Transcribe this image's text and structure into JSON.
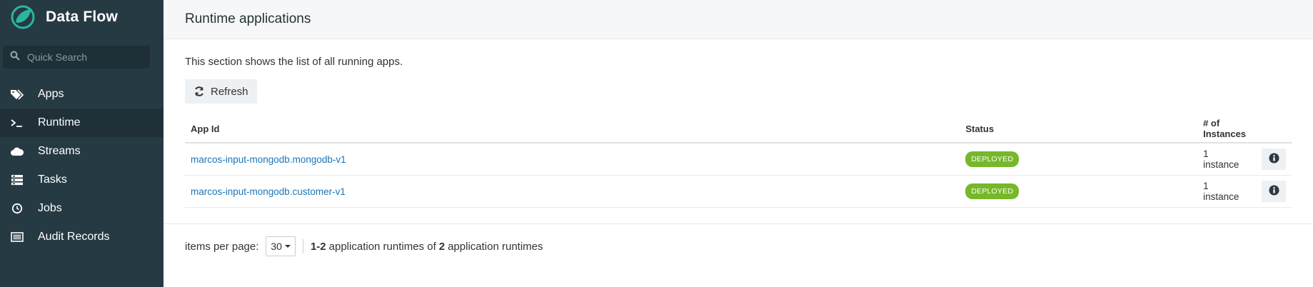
{
  "app": {
    "title": "Data Flow"
  },
  "sidebar": {
    "search_placeholder": "Quick Search",
    "items": [
      {
        "label": "Apps",
        "icon": "tags-icon"
      },
      {
        "label": "Runtime",
        "icon": "terminal-icon",
        "active": true
      },
      {
        "label": "Streams",
        "icon": "cloud-icon"
      },
      {
        "label": "Tasks",
        "icon": "tasks-icon"
      },
      {
        "label": "Jobs",
        "icon": "clock-icon"
      },
      {
        "label": "Audit Records",
        "icon": "list-icon"
      }
    ]
  },
  "header": {
    "title": "Runtime applications"
  },
  "main": {
    "description": "This section shows the list of all running apps.",
    "refresh_label": "Refresh",
    "table": {
      "columns": [
        "App Id",
        "Status",
        "# of Instances"
      ],
      "rows": [
        {
          "app_id": "marcos-input-mongodb.mongodb-v1",
          "status": "DEPLOYED",
          "instances": "1 instance"
        },
        {
          "app_id": "marcos-input-mongodb.customer-v1",
          "status": "DEPLOYED",
          "instances": "1 instance"
        }
      ]
    }
  },
  "pagination": {
    "items_per_page_label": "items per page:",
    "items_per_page_value": "30",
    "range": "1-2",
    "text_middle": "application runtimes of",
    "total": "2",
    "text_end": "application runtimes"
  },
  "colors": {
    "sidebar": "#263a44",
    "accent_link": "#1b76b8",
    "status_deployed": "#76b82a"
  }
}
